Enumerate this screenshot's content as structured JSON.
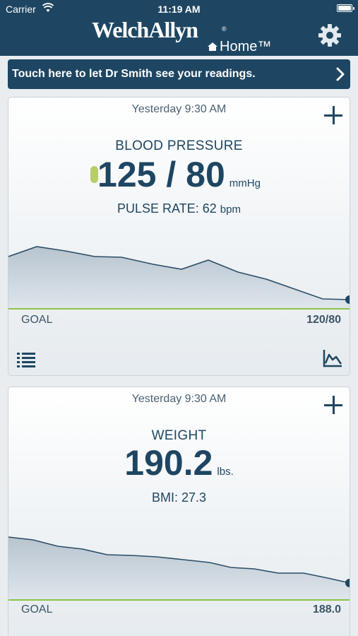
{
  "status_bar": {
    "carrier": "Carrier",
    "time": "11:19 AM"
  },
  "header": {
    "brand": "WelchAllyn",
    "brand_mark": "®",
    "brand_sub": "Home™"
  },
  "share_banner": {
    "text": "Touch here to let Dr Smith see your readings."
  },
  "blood_pressure": {
    "timestamp": "Yesterday 9:30 AM",
    "title": "BLOOD PRESSURE",
    "value": "125 / 80",
    "unit": "mmHg",
    "pulse": "PULSE RATE: 62",
    "pulse_unit": "bpm",
    "indicator_color": "#b7ce69",
    "goal_label": "GOAL",
    "goal_value": "120/80"
  },
  "weight": {
    "timestamp": "Yesterday 9:30 AM",
    "title": "WEIGHT",
    "value": "190.2",
    "unit": "lbs.",
    "bmi": "BMI: 27.3",
    "goal_label": "GOAL",
    "goal_value": "188.0"
  },
  "colors": {
    "navy": "#1e4662",
    "goal_line": "#8cc34a",
    "accent_green": "#b7ce69"
  },
  "icons": [
    "wifi-icon",
    "battery-icon",
    "gear-icon",
    "chevron-right-icon",
    "plus-icon",
    "list-icon",
    "trend-chart-icon"
  ]
}
